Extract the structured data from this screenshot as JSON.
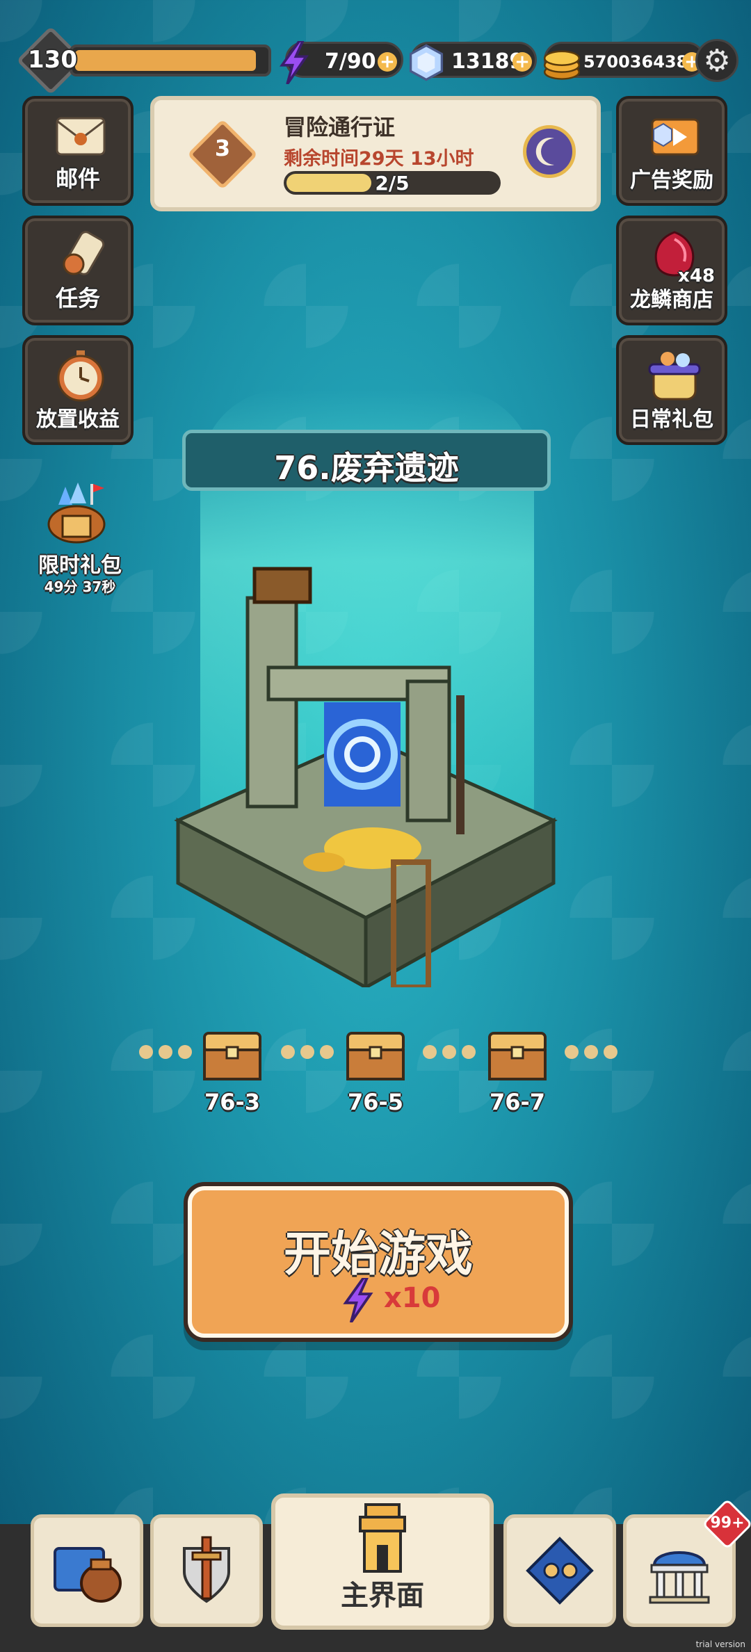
{
  "top": {
    "level": "130",
    "xp_progress": 0.95,
    "energy": "7/90",
    "gems": "13189",
    "coins": "570036438",
    "plus": "+"
  },
  "left_buttons": [
    {
      "label": "邮件",
      "icon": "mail-icon"
    },
    {
      "label": "任务",
      "icon": "scroll-icon"
    },
    {
      "label": "放置收益",
      "icon": "stopwatch-icon"
    }
  ],
  "right_buttons": [
    {
      "label": "广告奖励",
      "icon": "tv-icon"
    },
    {
      "label": "龙鳞商店",
      "icon": "dragon-scale-icon",
      "count": "x48"
    },
    {
      "label": "日常礼包",
      "icon": "gift-pot-icon"
    }
  ],
  "pass": {
    "level": "3",
    "title": "冒险通行证",
    "time_left": "剩余时间29天 13小时",
    "progress_text": "2/5",
    "progress": 0.4
  },
  "limited_gift": {
    "title": "限时礼包",
    "timer": "49分 37秒"
  },
  "stage": {
    "name": "76.废弃遗迹",
    "chests": [
      "76-3",
      "76-5",
      "76-7"
    ]
  },
  "start": {
    "label": "开始游戏",
    "cost": "x10"
  },
  "nav": {
    "main_label": "主界面",
    "badge": "99+"
  },
  "watermark": "trial version",
  "colors": {
    "accent": "#f0a455",
    "background": "#1a8fa6",
    "xp": "#e9a74c",
    "cost_red": "#d83a3a"
  }
}
